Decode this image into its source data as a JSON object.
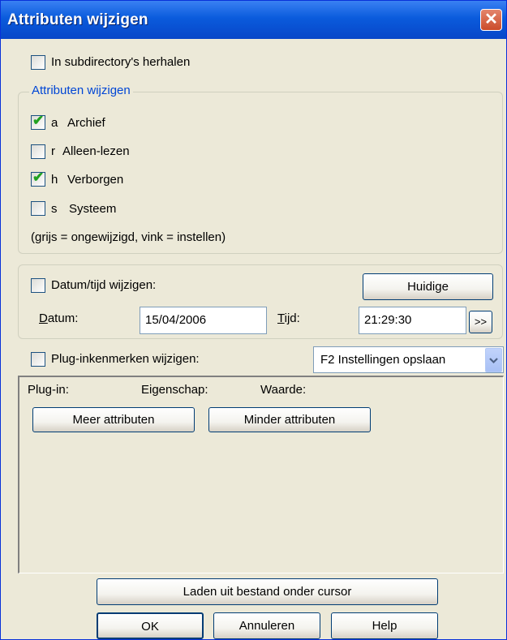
{
  "window": {
    "title": "Attributen wijzigen"
  },
  "recurse": {
    "label": "In subdirectory's herhalen",
    "checked": false
  },
  "attributes": {
    "legend": "Attributen wijzigen",
    "items": [
      {
        "letter": "a",
        "label": "Archief",
        "checked": true
      },
      {
        "letter": "r",
        "label": "Alleen-lezen",
        "checked": false
      },
      {
        "letter": "h",
        "label": "Verborgen",
        "checked": true
      },
      {
        "letter": "s",
        "label": "Systeem",
        "checked": false
      }
    ],
    "hint": "(grijs = ongewijzigd, vink = instellen)"
  },
  "datetime": {
    "label": "Datum/tijd wijzigen:",
    "checked": false,
    "current_button": "Huidige",
    "date_label": "Datum:",
    "date_value": "15/04/2006",
    "time_label": "Tijd:",
    "time_value": "21:29:30",
    "more_button": ">>"
  },
  "plugin": {
    "label": "Plug-inkenmerken wijzigen:",
    "checked": false,
    "dropdown_value": "F2 Instellingen opslaan",
    "columns": [
      "Plug-in:",
      "Eigenschap:",
      "Waarde:"
    ],
    "more_button": "Meer attributen",
    "less_button": "Minder attributen"
  },
  "load_button": "Laden uit bestand onder cursor",
  "footer": {
    "ok": "OK",
    "cancel": "Annuleren",
    "help": "Help"
  }
}
